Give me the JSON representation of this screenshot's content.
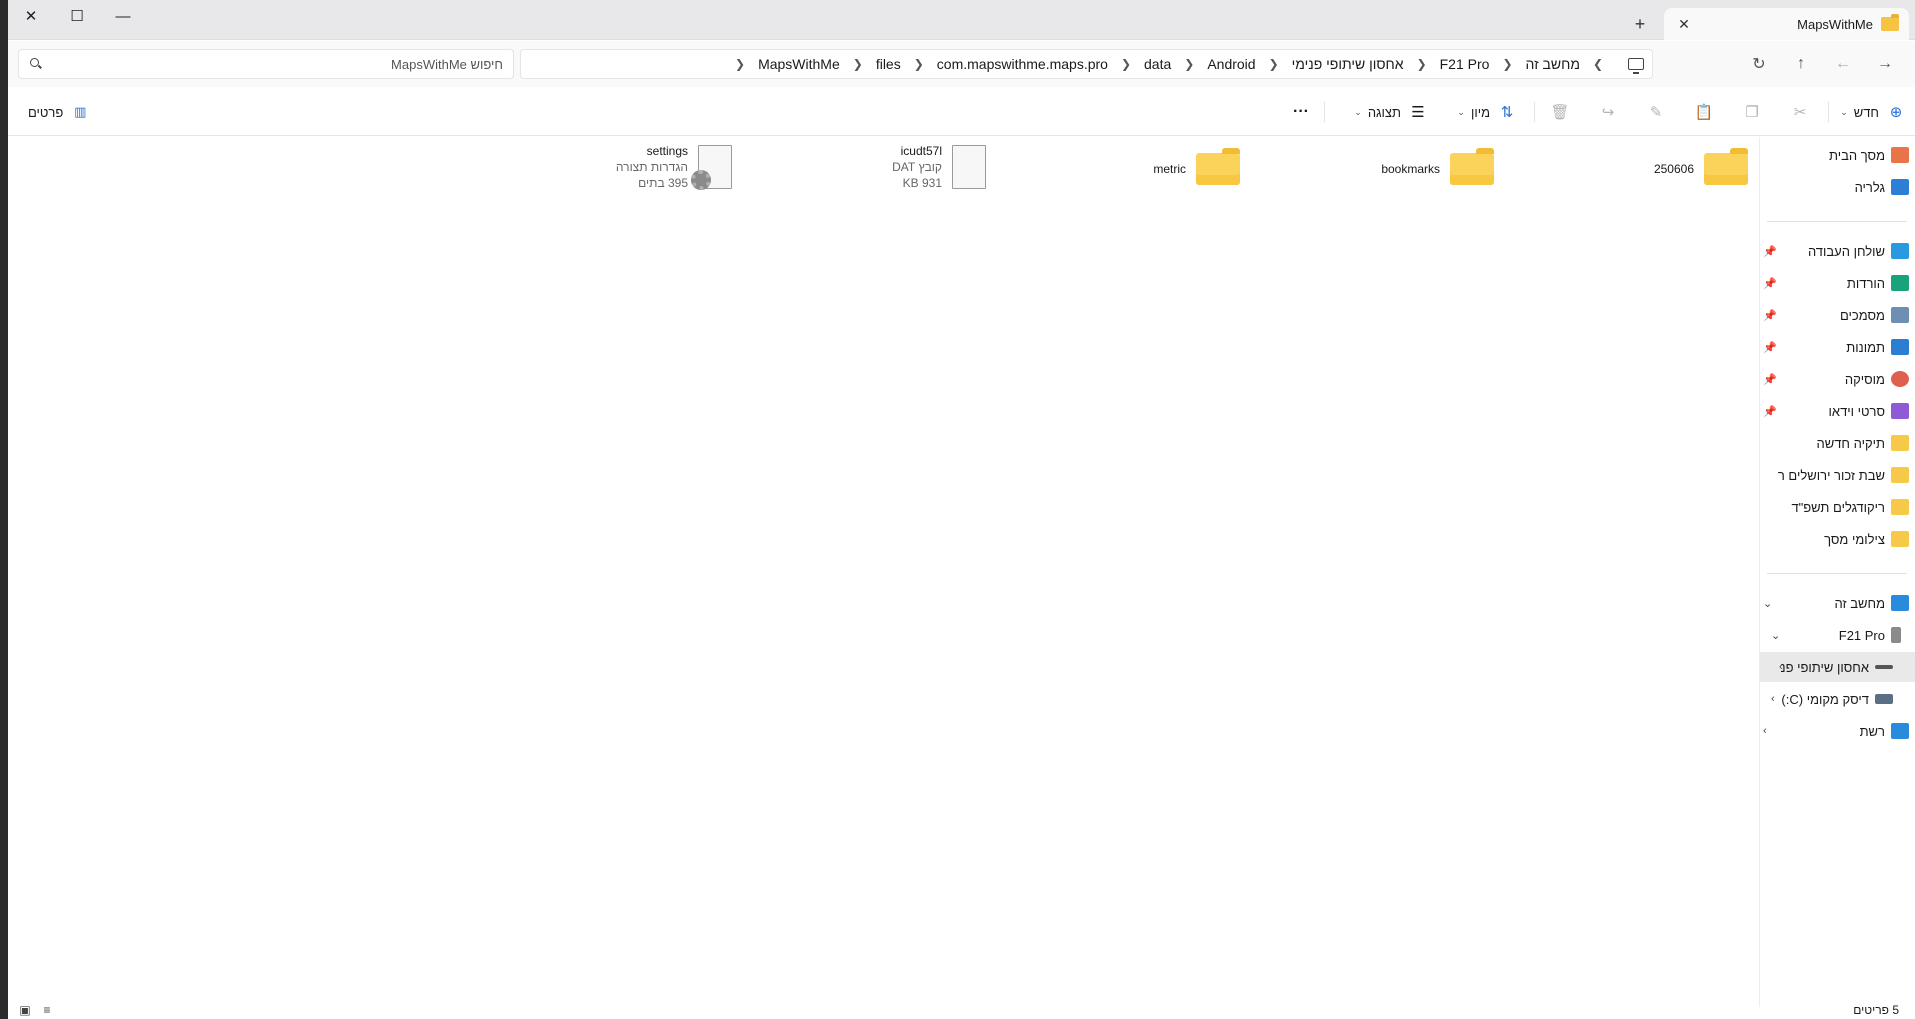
{
  "window": {
    "tab_title": "MapsWithMe",
    "new_tab_symbol": "+",
    "close_symbol": "✕",
    "minimize_symbol": "—",
    "maximize_symbol": "☐",
    "tab_close_symbol": "✕"
  },
  "nav": {
    "back_symbol": "→",
    "forward_symbol": "←",
    "up_symbol": "↑",
    "refresh_symbol": "↻",
    "breadcrumbs": [
      "מחשב זה",
      "F21 Pro",
      "אחסון שיתופי פנימי",
      "Android",
      "data",
      "com.mapswithme.maps.pro",
      "files",
      "MapsWithMe"
    ],
    "search_placeholder": "חיפוש MapsWithMe"
  },
  "commandbar": {
    "new_label": "חדש",
    "sort_label": "מיון",
    "view_label": "תצוגה",
    "more_symbol": "···",
    "details_label": "פרטים",
    "icons": {
      "new": "plus-circle-icon",
      "cut": "scissors-icon",
      "copy": "copy-icon",
      "paste": "paste-icon",
      "rename": "rename-icon",
      "share": "share-icon",
      "delete": "trash-icon"
    }
  },
  "sidebar": {
    "items": [
      {
        "label": "מסך הבית",
        "icon": "home-icon",
        "color": "#e8744a"
      },
      {
        "label": "גלריה",
        "icon": "gallery-icon",
        "color": "#2d7fd6"
      },
      {
        "label": "שולחן העבודה",
        "icon": "desktop-icon",
        "color": "#2a9ae0",
        "pinned": true
      },
      {
        "label": "הורדות",
        "icon": "download-icon",
        "color": "#1aa27a",
        "pinned": true
      },
      {
        "label": "מסמכים",
        "icon": "documents-icon",
        "color": "#6d8fb3",
        "pinned": true
      },
      {
        "label": "תמונות",
        "icon": "pictures-icon",
        "color": "#2c7fd0",
        "pinned": true
      },
      {
        "label": "מוסיקה",
        "icon": "music-icon",
        "color": "#e0604e",
        "pinned": true
      },
      {
        "label": "סרטי וידאו",
        "icon": "videos-icon",
        "color": "#8e5ad6",
        "pinned": true
      },
      {
        "label": "תיקיה חדשה",
        "icon": "folder-icon",
        "color": "#f7c948"
      },
      {
        "label": "שבת זכור ירושלים ר",
        "icon": "folder-icon",
        "color": "#f7c948"
      },
      {
        "label": "ריקודגלים תשפ\"ד",
        "icon": "folder-icon",
        "color": "#f7c948"
      },
      {
        "label": "צילומי מסך",
        "icon": "folder-icon",
        "color": "#f7c948"
      },
      {
        "label": "מחשב זה",
        "icon": "this-pc-icon",
        "color": "#2a8bdc"
      },
      {
        "label": "F21 Pro",
        "icon": "phone-icon",
        "color": "#8a8a8a"
      },
      {
        "label": "אחסון שיתופי פנ",
        "icon": "storage-icon",
        "color": "#555555"
      },
      {
        "label": "דיסק מקומי (C:)",
        "icon": "disk-icon",
        "color": "#5a6e85"
      },
      {
        "label": "רשת",
        "icon": "network-icon",
        "color": "#2a8bdc"
      }
    ]
  },
  "files": [
    {
      "name": "250606",
      "type": "folder",
      "icon": "folder-icon"
    },
    {
      "name": "bookmarks",
      "type": "folder",
      "icon": "folder-icon"
    },
    {
      "name": "metric",
      "type": "folder",
      "icon": "folder-icon"
    },
    {
      "name": "icudt57l",
      "type": "file",
      "icon": "file-icon",
      "subtype": "קובץ DAT",
      "size": "931 KB"
    },
    {
      "name": "settings",
      "type": "file",
      "icon": "settings-file-icon",
      "subtype": "הגדרות תצורה",
      "size": "395 בתים"
    }
  ],
  "status": {
    "item_count": "5 פריטים"
  }
}
